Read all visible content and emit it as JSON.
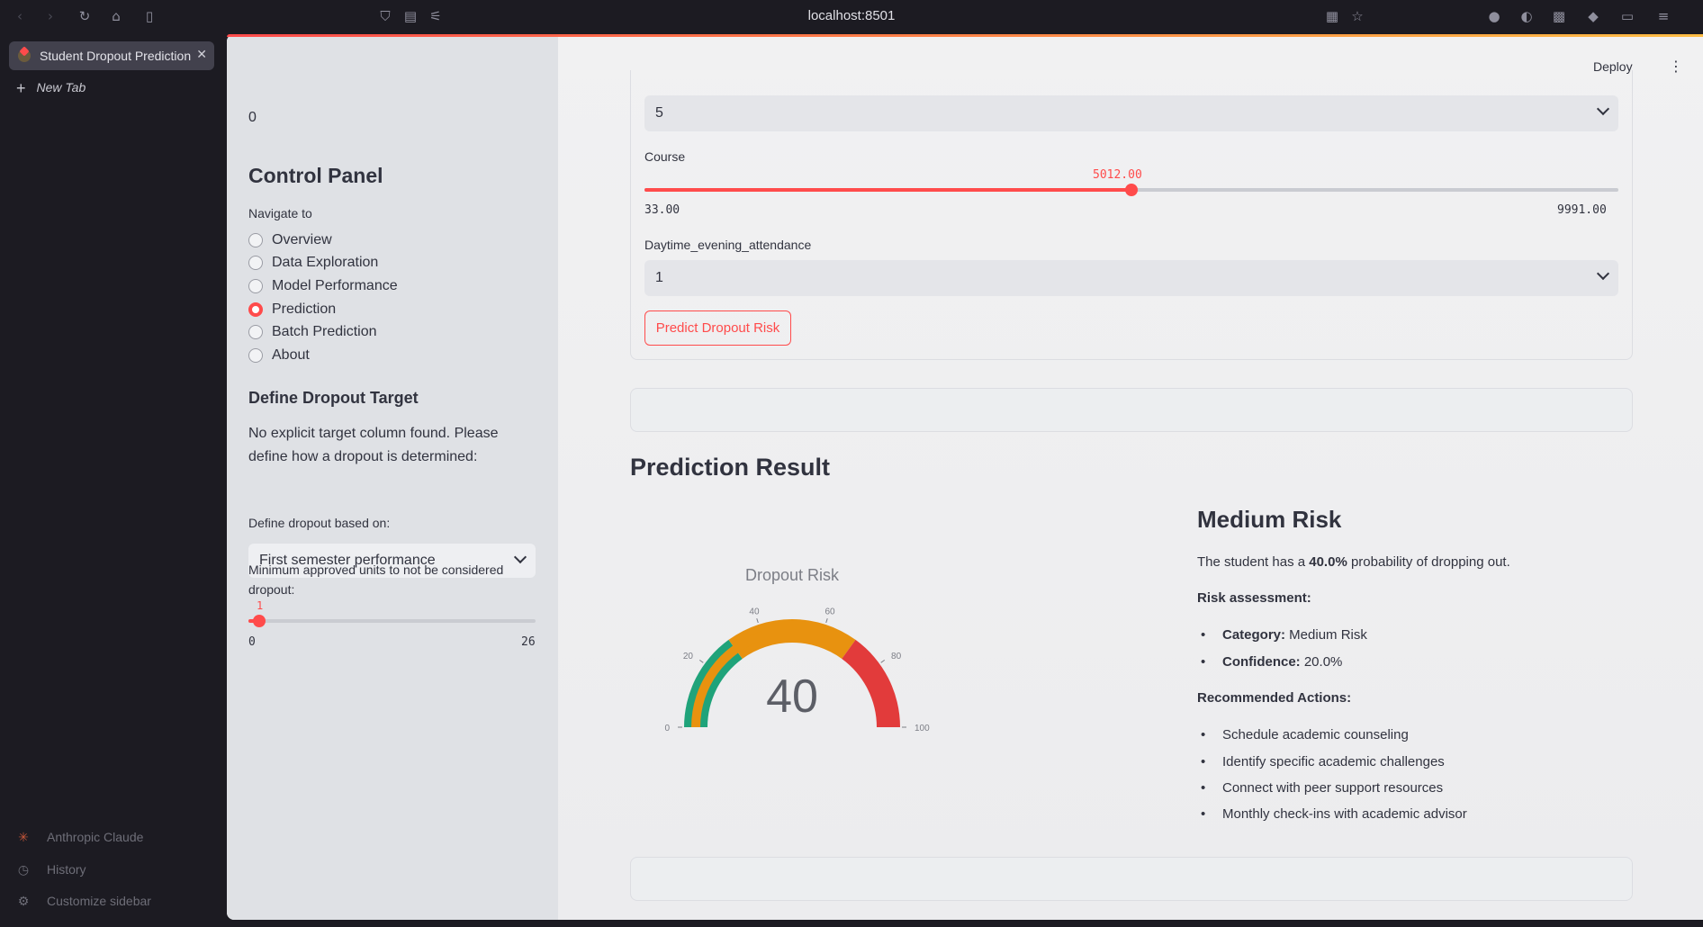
{
  "browser": {
    "url": "localhost:8501",
    "tab_title": "Student Dropout Prediction",
    "new_tab_label": "New Tab",
    "footer": [
      {
        "label": "Anthropic Claude",
        "icon": "claude-icon"
      },
      {
        "label": "History",
        "icon": "history-icon"
      },
      {
        "label": "Customize sidebar",
        "icon": "gear-icon"
      }
    ]
  },
  "sidebar": {
    "top_value": "0",
    "title": "Control Panel",
    "nav_label": "Navigate to",
    "nav_items": [
      {
        "label": "Overview",
        "selected": false
      },
      {
        "label": "Data Exploration",
        "selected": false
      },
      {
        "label": "Model Performance",
        "selected": false
      },
      {
        "label": "Prediction",
        "selected": true
      },
      {
        "label": "Batch Prediction",
        "selected": false
      },
      {
        "label": "About",
        "selected": false
      }
    ],
    "target_title": "Define Dropout Target",
    "target_text": "No explicit target column found. Please define how a dropout is determined:",
    "dropout_basis_label": "Define dropout based on:",
    "dropout_basis_value": "First semester performance",
    "min_units_label": "Minimum approved units to not be considered dropout:",
    "min_units_slider": {
      "value": "1",
      "min": "0",
      "max": "26",
      "fraction": 0.0385
    }
  },
  "main": {
    "deploy_label": "Deploy",
    "top_select_value": "5",
    "course": {
      "label": "Course",
      "value": "5012.00",
      "min": "33.00",
      "max": "9991.00",
      "fraction": 0.5
    },
    "attendance": {
      "label": "Daytime_evening_attendance",
      "value": "1"
    },
    "predict_button": "Predict Dropout Risk",
    "result_title": "Prediction Result",
    "gauge": {
      "title": "Dropout Risk",
      "value": 40,
      "ticks": [
        "0",
        "20",
        "40",
        "60",
        "80",
        "100"
      ],
      "colors": {
        "low": "#1fa37a",
        "medium": "#e8920f",
        "high": "#e23b3b"
      }
    },
    "risk_heading": "Medium Risk",
    "summary_prefix": "The student has a ",
    "summary_prob": "40.0%",
    "summary_suffix": " probability of dropping out.",
    "assessment_label": "Risk assessment:",
    "category_key": "Category:",
    "category_value": " Medium Risk",
    "confidence_key": "Confidence:",
    "confidence_value": " 20.0%",
    "actions_label": "Recommended Actions:",
    "actions": [
      "Schedule academic counseling",
      "Identify specific academic challenges",
      "Connect with peer support resources",
      "Monthly check-ins with academic advisor"
    ]
  },
  "colors": {
    "accent": "#ff4b4b",
    "text": "#31333f"
  }
}
